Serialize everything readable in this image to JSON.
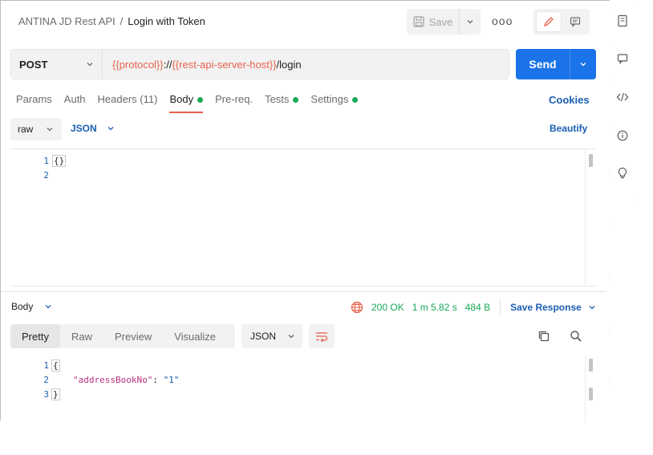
{
  "header": {
    "breadcrumb_parent": "ANTINA JD Rest API",
    "breadcrumb_separator": "/",
    "breadcrumb_current": "Login with Token",
    "save_label": "Save",
    "more_label": "ooo"
  },
  "request": {
    "method": "POST",
    "url_var_protocol": "{{protocol}}",
    "url_sep": "://",
    "url_var_host": "{{rest-api-server-host}}",
    "url_path": "/login",
    "send_label": "Send"
  },
  "tabs": [
    {
      "label": "Params",
      "dot": false
    },
    {
      "label": "Auth",
      "dot": false
    },
    {
      "label": "Headers (11)",
      "dot": false
    },
    {
      "label": "Body",
      "dot": true,
      "active": true
    },
    {
      "label": "Pre-req.",
      "dot": false
    },
    {
      "label": "Tests",
      "dot": true
    },
    {
      "label": "Settings",
      "dot": true
    }
  ],
  "cookies_label": "Cookies",
  "body_options": {
    "type": "raw",
    "language": "JSON",
    "beautify_label": "Beautify"
  },
  "request_editor": {
    "lines": [
      "1",
      "2"
    ],
    "code_line1": "{}"
  },
  "response": {
    "label": "Body",
    "status": "200 OK",
    "time": "1 m 5.82 s",
    "size": "484 B",
    "save_label": "Save Response",
    "tabs": [
      "Pretty",
      "Raw",
      "Preview",
      "Visualize"
    ],
    "active_tab": "Pretty",
    "format": "JSON",
    "lines": [
      "1",
      "2",
      "3"
    ],
    "code_open": "{",
    "code_key": "\"addressBookNo\"",
    "code_colon": ": ",
    "code_value": "\"1\"",
    "code_close": "}"
  },
  "colors": {
    "accent": "#1a73e8",
    "variable": "#e8614d",
    "success": "#18a957",
    "link": "#1a5fb4"
  }
}
